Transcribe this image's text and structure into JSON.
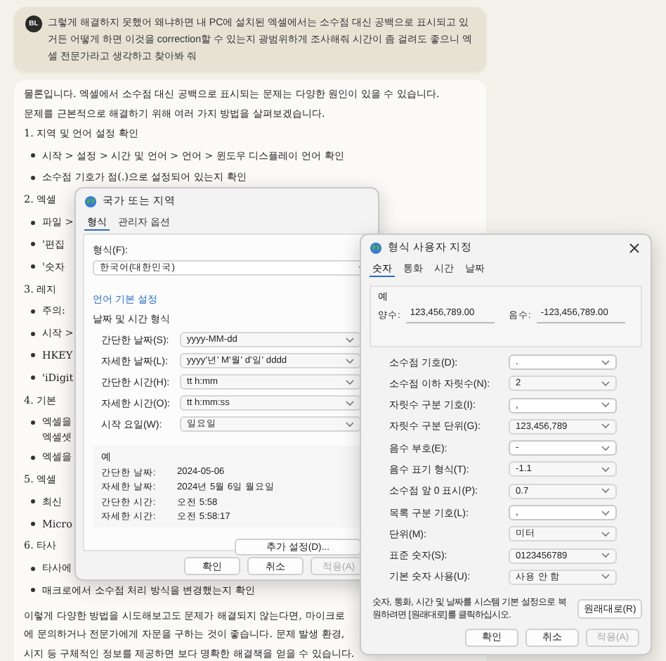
{
  "user_message": {
    "avatar": "BL",
    "text": "그렇게 해결하지 못했어 왜냐하면 내 PC에 설치된 엑셀에서는 소수점 대신 공백으로 표시되고 있거든 어떻게 하면 이것을 correction할 수 있는지 광범위하게 조사해줘 시간이 좀 걸려도 좋으니 엑셀 전문가라고 생각하고 찾아봐 줘"
  },
  "answer": {
    "lines": [
      {
        "kind": "para",
        "text": "물론입니다. 엑셀에서 소수점 대신 공백으로 표시되는 문제는 다양한 원인이 있을 수 있습니다."
      },
      {
        "kind": "para",
        "text": "문제를 근본적으로 해결하기 위해 여러 가지 방법을 살펴보겠습니다."
      },
      {
        "kind": "heading",
        "text": "1. 지역 및 언어 설정 확인"
      },
      {
        "kind": "bullet",
        "text": "시작 > 설정 > 시간 및 언어 > 언어 > 윈도우 디스플레이 언어 확인"
      },
      {
        "kind": "bullet",
        "text": "소수점 기호가 점(.)으로 설정되어 있는지 확인"
      },
      {
        "kind": "heading",
        "text": "2. 엑셀"
      },
      {
        "kind": "bullet",
        "text": "파일 >"
      },
      {
        "kind": "bullet",
        "text": "'편집"
      },
      {
        "kind": "bullet",
        "text": "'숫자"
      },
      {
        "kind": "heading",
        "text": "3. 레지"
      },
      {
        "kind": "bullet",
        "text": "주의:"
      },
      {
        "kind": "bullet",
        "text": "시작 >"
      },
      {
        "kind": "bullet",
        "text": "HKEY"
      },
      {
        "kind": "bullet",
        "text": "'iDigit"
      },
      {
        "kind": "heading",
        "text": "4. 기본"
      },
      {
        "kind": "bullet",
        "text": "엑셀을"
      },
      {
        "kind": "cont",
        "text": "엑셀셋"
      },
      {
        "kind": "bullet",
        "text": "엑셀을"
      },
      {
        "kind": "heading",
        "text": "5. 엑셀"
      },
      {
        "kind": "bullet",
        "text": "최신"
      },
      {
        "kind": "bullet",
        "text": "Micro"
      },
      {
        "kind": "heading",
        "text": "6. 타사"
      },
      {
        "kind": "bullet",
        "text": "타사에"
      },
      {
        "kind": "bullet",
        "text": "매크로에서 소수점 처리 방식을 변경했는지 확인"
      },
      {
        "kind": "para",
        "text": "이렇게 다양한 방법을 시도해보고도 문제가 해결되지 않는다면, 마이크로"
      },
      {
        "kind": "para",
        "text": "에 문의하거나 전문가에게 자문을 구하는 것이 좋습니다. 문제 발생 환경,"
      },
      {
        "kind": "para",
        "text": "시지 등 구체적인 정보를 제공하면 보다 명확한 해결책을 얻을 수 있습니다."
      }
    ]
  },
  "region_dialog": {
    "title": "국가 또는 지역",
    "tabs": [
      {
        "label": "형식",
        "selected": true
      },
      {
        "label": "관리자 옵션",
        "selected": false
      }
    ],
    "format_label": "형식(F):",
    "format_value": "한국어(대한민국)",
    "language_link": "언어 기본 설정",
    "group_title": "날짜 및 시간 형식",
    "formats": [
      {
        "label": "간단한 날짜(S):",
        "value": "yyyy-MM-dd"
      },
      {
        "label": "자세한 날짜(L):",
        "value": "yyyy'년' M'월' d'일' dddd"
      },
      {
        "label": "간단한 시간(H):",
        "value": "tt h:mm"
      },
      {
        "label": "자세한 시간(O):",
        "value": "tt h:mm:ss"
      },
      {
        "label": "시작 요일(W):",
        "value": "일요일"
      }
    ],
    "example_title": "예",
    "examples": [
      {
        "label": "간단한 날짜:",
        "value": "2024-05-06"
      },
      {
        "label": "자세한 날짜:",
        "value": "2024년 5월 6일 월요일"
      },
      {
        "label": "간단한 시간:",
        "value": "오전 5:58"
      },
      {
        "label": "자세한 시간:",
        "value": "오전 5:58:17"
      }
    ],
    "additional_button": "추가 설정(D)...",
    "buttons": [
      {
        "label": "확인",
        "disabled": false
      },
      {
        "label": "취소",
        "disabled": false
      },
      {
        "label": "적용(A)",
        "disabled": true
      }
    ]
  },
  "customize_dialog": {
    "title": "형식 사용자 지정",
    "tabs": [
      {
        "label": "숫자",
        "selected": true
      },
      {
        "label": "통화",
        "selected": false
      },
      {
        "label": "시간",
        "selected": false
      },
      {
        "label": "날짜",
        "selected": false
      }
    ],
    "example_title": "예",
    "positive_label": "양수:",
    "positive_value": "123,456,789.00",
    "negative_label": "음수:",
    "negative_value": "-123,456,789.00",
    "settings": [
      {
        "label": "소수점 기호(D):",
        "value": ".",
        "editable": true
      },
      {
        "label": "소수점 이하 자릿수(N):",
        "value": "2",
        "editable": false
      },
      {
        "label": "자릿수 구분 기호(I):",
        "value": ",",
        "editable": true
      },
      {
        "label": "자릿수 구분 단위(G):",
        "value": "123,456,789",
        "editable": false
      },
      {
        "label": "음수 부호(E):",
        "value": "-",
        "editable": true
      },
      {
        "label": "음수 표기 형식(T):",
        "value": "-1.1",
        "editable": false
      },
      {
        "label": "소수점 앞 0 표시(P):",
        "value": "0.7",
        "editable": false
      },
      {
        "label": "목록 구분 기호(L):",
        "value": ",",
        "editable": true
      },
      {
        "label": "단위(M):",
        "value": "미터",
        "editable": false
      },
      {
        "label": "표준 숫자(S):",
        "value": "0123456789",
        "editable": false
      },
      {
        "label": "기본 숫자 사용(U):",
        "value": "사용 안 함",
        "editable": false
      }
    ],
    "reset_note": "숫자, 통화, 시간 및 날짜를 시스템 기본 설정으로 복원하려면 [원래대로]를 클릭하십시오.",
    "reset_button": "원래대로(R)",
    "buttons": [
      {
        "label": "확인",
        "disabled": false
      },
      {
        "label": "취소",
        "disabled": false
      },
      {
        "label": "적용(A)",
        "disabled": true
      }
    ]
  }
}
